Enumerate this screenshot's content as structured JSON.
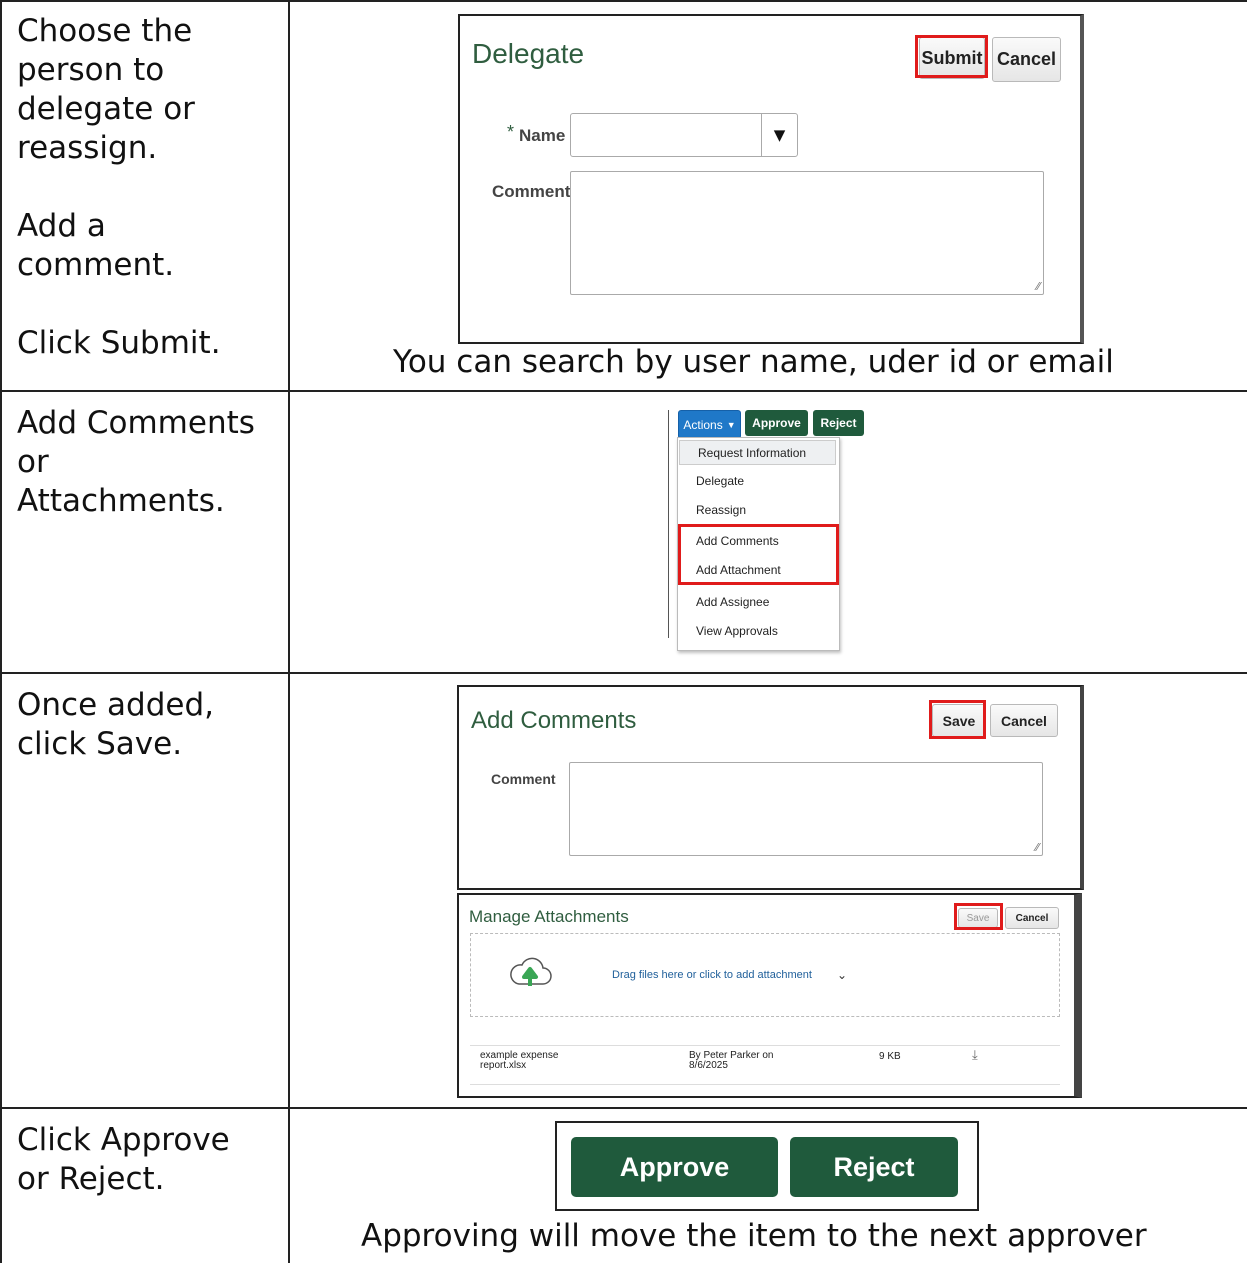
{
  "rows": [
    {
      "instruction": "Choose the\nperson to\ndelegate or\nreassign.\n\nAdd a\ncomment.\n\nClick Submit.",
      "caption": "You can search by user name, uder id or email"
    },
    {
      "instruction": "Add Comments\nor\nAttachments."
    },
    {
      "instruction": "Once added,\nclick Save."
    },
    {
      "instruction": "Click Approve\nor Reject.",
      "caption": "Approving will move the item to the next approver"
    }
  ],
  "delegate_dialog": {
    "title": "Delegate",
    "submit_label": "Submit",
    "cancel_label": "Cancel",
    "required_mark": "*",
    "name_label": "Name",
    "name_value": "",
    "comment_label": "Comment",
    "comment_value": ""
  },
  "actions_menu": {
    "actions_label": "Actions",
    "approve_label": "Approve",
    "reject_label": "Reject",
    "items": [
      "Request Information",
      "Delegate",
      "Reassign",
      "Add Comments",
      "Add Attachment",
      "Add Assignee",
      "View Approvals"
    ],
    "highlighted_items": [
      "Add Comments",
      "Add Attachment"
    ]
  },
  "add_comments_dialog": {
    "title": "Add Comments",
    "save_label": "Save",
    "cancel_label": "Cancel",
    "comment_label": "Comment",
    "comment_value": ""
  },
  "manage_attachments": {
    "title": "Manage Attachments",
    "save_label": "Save",
    "cancel_label": "Cancel",
    "dropzone_text": "Drag files here or click to add attachment",
    "file": {
      "name": "example expense\nreport.xlsx",
      "uploaded_by": "By Peter Parker on\n8/6/2025",
      "size": "9 KB"
    },
    "colors": {
      "upload_arrow": "#3aa655",
      "link": "#1f5f9a"
    }
  },
  "decision_buttons": {
    "approve_label": "Approve",
    "reject_label": "Reject",
    "color": "#1f5a3c"
  },
  "colors": {
    "accent_green": "#1f5a3c",
    "highlight_red": "#e01b1b",
    "actions_blue": "#1f78c8",
    "title_green": "#2f5d3f"
  }
}
